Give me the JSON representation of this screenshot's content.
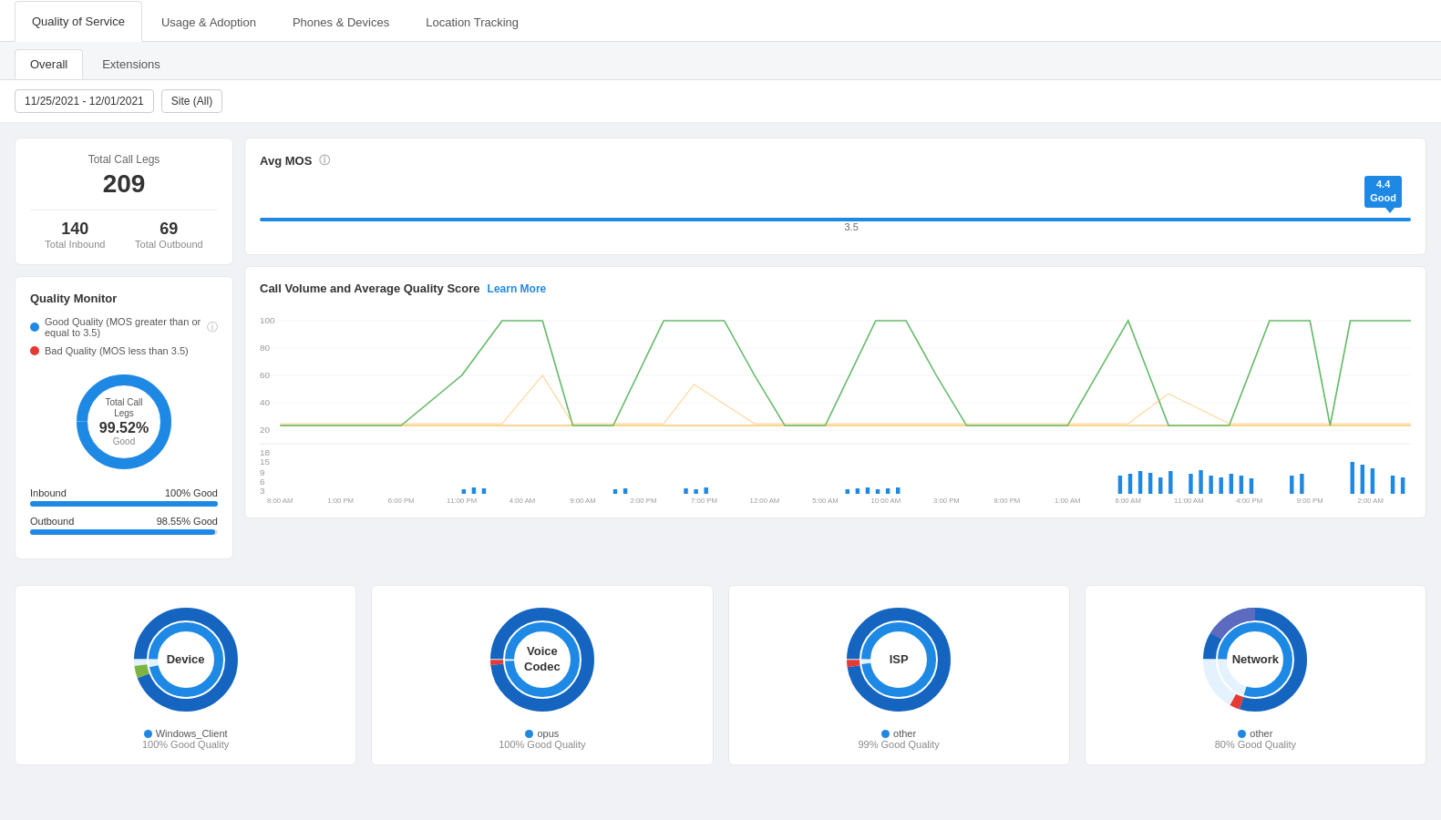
{
  "tabs": {
    "top": [
      {
        "id": "qos",
        "label": "Quality of Service",
        "active": true
      },
      {
        "id": "usage",
        "label": "Usage & Adoption",
        "active": false
      },
      {
        "id": "phones",
        "label": "Phones & Devices",
        "active": false
      },
      {
        "id": "location",
        "label": "Location Tracking",
        "active": false
      }
    ],
    "sub": [
      {
        "id": "overall",
        "label": "Overall",
        "active": true
      },
      {
        "id": "extensions",
        "label": "Extensions",
        "active": false
      }
    ]
  },
  "filters": {
    "date": "11/25/2021 - 12/01/2021",
    "site": "Site (All)"
  },
  "stats": {
    "total_call_legs_label": "Total Call Legs",
    "total_call_legs": "209",
    "total_inbound": "140",
    "total_inbound_label": "Total Inbound",
    "total_outbound": "69",
    "total_outbound_label": "Total Outbound"
  },
  "quality_monitor": {
    "title": "Quality Monitor",
    "legend_good": "Good Quality (MOS greater than or equal to 3.5)",
    "legend_bad": "Bad Quality (MOS less than 3.5)",
    "donut_title": "Total Call Legs",
    "donut_pct": "99.52",
    "donut_quality": "Good",
    "inbound_label": "Inbound",
    "inbound_pct": "100% Good",
    "outbound_label": "Outbound",
    "outbound_pct": "98.55% Good"
  },
  "avg_mos": {
    "title": "Avg MOS",
    "value": "4.4",
    "quality_label": "Good",
    "threshold": "3.5"
  },
  "call_volume": {
    "title": "Call Volume and Average Quality Score",
    "learn_more": "Learn More"
  },
  "bottom_charts": [
    {
      "id": "device",
      "label": "Device",
      "legend_name": "Windows_Client",
      "pct": "100% Good Quality"
    },
    {
      "id": "voice_codec",
      "label": "Voice\nCodec",
      "legend_name": "opus",
      "pct": "100% Good Quality"
    },
    {
      "id": "isp",
      "label": "ISP",
      "legend_name": "other",
      "pct": "99% Good Quality"
    },
    {
      "id": "network",
      "label": "Network",
      "legend_name": "other",
      "pct": "80% Good Quality"
    }
  ]
}
